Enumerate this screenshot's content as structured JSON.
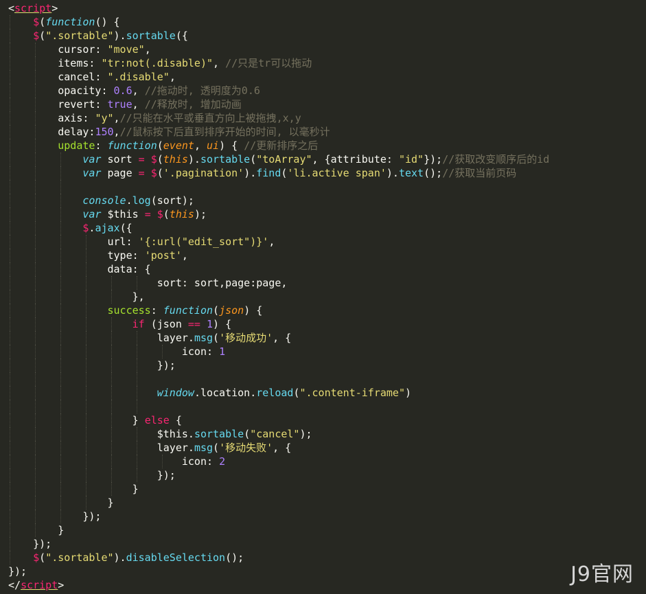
{
  "colors": {
    "background": "#272822",
    "plain": "#f8f8f2",
    "tag": "#f92672",
    "string": "#e6db74",
    "number": "#ae81ff",
    "comment": "#75715e",
    "keyword": "#f92672",
    "function": "#66d9ef",
    "param": "#fd971f",
    "property": "#a6e22e"
  },
  "code": {
    "lines": [
      {
        "indent": 0,
        "tokens": [
          [
            "plain",
            "<"
          ],
          [
            "tag-u",
            "script"
          ],
          [
            "plain",
            ">"
          ]
        ]
      },
      {
        "indent": 1,
        "tokens": [
          [
            "kw",
            "$"
          ],
          [
            "plain",
            "("
          ],
          [
            "fn-i",
            "function"
          ],
          [
            "plain",
            "() {"
          ]
        ]
      },
      {
        "indent": 1,
        "tokens": [
          [
            "kw",
            "$"
          ],
          [
            "plain",
            "("
          ],
          [
            "str",
            "\".sortable\""
          ],
          [
            "plain",
            ")."
          ],
          [
            "fn",
            "sortable"
          ],
          [
            "plain",
            "({"
          ]
        ]
      },
      {
        "indent": 2,
        "tokens": [
          [
            "plain",
            "cursor: "
          ],
          [
            "str",
            "\"move\""
          ],
          [
            "plain",
            ","
          ]
        ]
      },
      {
        "indent": 2,
        "tokens": [
          [
            "plain",
            "items: "
          ],
          [
            "str",
            "\"tr:not(.disable)\""
          ],
          [
            "plain",
            ", "
          ],
          [
            "comment",
            "//只是tr可以拖动"
          ]
        ]
      },
      {
        "indent": 2,
        "tokens": [
          [
            "plain",
            "cancel: "
          ],
          [
            "str",
            "\".disable\""
          ],
          [
            "plain",
            ","
          ]
        ]
      },
      {
        "indent": 2,
        "tokens": [
          [
            "plain",
            "opacity: "
          ],
          [
            "num",
            "0.6"
          ],
          [
            "plain",
            ", "
          ],
          [
            "comment",
            "//拖动时, 透明度为0.6"
          ]
        ]
      },
      {
        "indent": 2,
        "tokens": [
          [
            "plain",
            "revert: "
          ],
          [
            "num",
            "true"
          ],
          [
            "plain",
            ", "
          ],
          [
            "comment",
            "//释放时, 增加动画"
          ]
        ]
      },
      {
        "indent": 2,
        "tokens": [
          [
            "plain",
            "axis: "
          ],
          [
            "str",
            "\"y\""
          ],
          [
            "plain",
            ","
          ],
          [
            "comment",
            "//只能在水平或垂直方向上被拖拽,x,y"
          ]
        ]
      },
      {
        "indent": 2,
        "tokens": [
          [
            "plain",
            "delay:"
          ],
          [
            "num",
            "150"
          ],
          [
            "plain",
            ","
          ],
          [
            "comment",
            "//鼠标按下后直到排序开始的时间, 以毫秒计"
          ]
        ]
      },
      {
        "indent": 2,
        "tokens": [
          [
            "prop",
            "update"
          ],
          [
            "plain",
            ": "
          ],
          [
            "fn-i",
            "function"
          ],
          [
            "plain",
            "("
          ],
          [
            "param",
            "event"
          ],
          [
            "plain",
            ", "
          ],
          [
            "param",
            "ui"
          ],
          [
            "plain",
            ") { "
          ],
          [
            "comment",
            "//更新排序之后"
          ]
        ]
      },
      {
        "indent": 3,
        "tokens": [
          [
            "fn-i",
            "var"
          ],
          [
            "plain",
            " sort "
          ],
          [
            "kw",
            "="
          ],
          [
            "plain",
            " "
          ],
          [
            "kw",
            "$"
          ],
          [
            "plain",
            "("
          ],
          [
            "this",
            "this"
          ],
          [
            "plain",
            ")."
          ],
          [
            "fn",
            "sortable"
          ],
          [
            "plain",
            "("
          ],
          [
            "str",
            "\"toArray\""
          ],
          [
            "plain",
            ", {attribute: "
          ],
          [
            "str",
            "\"id\""
          ],
          [
            "plain",
            "});"
          ],
          [
            "comment",
            "//获取改变顺序后的id"
          ]
        ]
      },
      {
        "indent": 3,
        "tokens": [
          [
            "fn-i",
            "var"
          ],
          [
            "plain",
            " page "
          ],
          [
            "kw",
            "="
          ],
          [
            "plain",
            " "
          ],
          [
            "kw",
            "$"
          ],
          [
            "plain",
            "("
          ],
          [
            "str",
            "'.pagination'"
          ],
          [
            "plain",
            ")."
          ],
          [
            "fn",
            "find"
          ],
          [
            "plain",
            "("
          ],
          [
            "str",
            "'li.active span'"
          ],
          [
            "plain",
            ")."
          ],
          [
            "fn",
            "text"
          ],
          [
            "plain",
            "();"
          ],
          [
            "comment",
            "//获取当前页码"
          ]
        ]
      },
      {
        "indent": 3,
        "tokens": []
      },
      {
        "indent": 3,
        "tokens": [
          [
            "fn-i",
            "console"
          ],
          [
            "plain",
            "."
          ],
          [
            "fn",
            "log"
          ],
          [
            "plain",
            "(sort);"
          ]
        ]
      },
      {
        "indent": 3,
        "tokens": [
          [
            "fn-i",
            "var"
          ],
          [
            "plain",
            " $this "
          ],
          [
            "kw",
            "="
          ],
          [
            "plain",
            " "
          ],
          [
            "kw",
            "$"
          ],
          [
            "plain",
            "("
          ],
          [
            "this",
            "this"
          ],
          [
            "plain",
            ");"
          ]
        ]
      },
      {
        "indent": 3,
        "tokens": [
          [
            "kw",
            "$"
          ],
          [
            "plain",
            "."
          ],
          [
            "fn",
            "ajax"
          ],
          [
            "plain",
            "({"
          ]
        ]
      },
      {
        "indent": 4,
        "tokens": [
          [
            "plain",
            "url: "
          ],
          [
            "str",
            "'{:url(\"edit_sort\")}'"
          ],
          [
            "plain",
            ","
          ]
        ]
      },
      {
        "indent": 4,
        "tokens": [
          [
            "plain",
            "type: "
          ],
          [
            "str",
            "'post'"
          ],
          [
            "plain",
            ","
          ]
        ]
      },
      {
        "indent": 4,
        "tokens": [
          [
            "plain",
            "data: {"
          ]
        ]
      },
      {
        "indent": 6,
        "pad": "    ",
        "tokens": [
          [
            "plain",
            "sort: sort,page:page,"
          ]
        ]
      },
      {
        "indent": 5,
        "tokens": [
          [
            "plain",
            "},"
          ]
        ]
      },
      {
        "indent": 4,
        "tokens": [
          [
            "prop",
            "success"
          ],
          [
            "plain",
            ": "
          ],
          [
            "fn-i",
            "function"
          ],
          [
            "plain",
            "("
          ],
          [
            "param",
            "json"
          ],
          [
            "plain",
            ") {"
          ]
        ]
      },
      {
        "indent": 5,
        "tokens": [
          [
            "kw",
            "if"
          ],
          [
            "plain",
            " (json "
          ],
          [
            "kw",
            "=="
          ],
          [
            "plain",
            " "
          ],
          [
            "num",
            "1"
          ],
          [
            "plain",
            ") {"
          ]
        ]
      },
      {
        "indent": 6,
        "tokens": [
          [
            "plain",
            "layer."
          ],
          [
            "fn",
            "msg"
          ],
          [
            "plain",
            "("
          ],
          [
            "str",
            "'移动成功'"
          ],
          [
            "plain",
            ", {"
          ]
        ]
      },
      {
        "indent": 7,
        "tokens": [
          [
            "plain",
            "icon: "
          ],
          [
            "num",
            "1"
          ]
        ]
      },
      {
        "indent": 6,
        "tokens": [
          [
            "plain",
            "});"
          ]
        ]
      },
      {
        "indent": 6,
        "tokens": []
      },
      {
        "indent": 6,
        "tokens": [
          [
            "fn-i",
            "window"
          ],
          [
            "plain",
            ".location."
          ],
          [
            "fn",
            "reload"
          ],
          [
            "plain",
            "("
          ],
          [
            "str",
            "\".content-iframe\""
          ],
          [
            "plain",
            ")"
          ]
        ]
      },
      {
        "indent": 6,
        "tokens": []
      },
      {
        "indent": 5,
        "tokens": [
          [
            "plain",
            "} "
          ],
          [
            "kw",
            "else"
          ],
          [
            "plain",
            " {"
          ]
        ]
      },
      {
        "indent": 6,
        "tokens": [
          [
            "plain",
            "$this."
          ],
          [
            "fn",
            "sortable"
          ],
          [
            "plain",
            "("
          ],
          [
            "str",
            "\"cancel\""
          ],
          [
            "plain",
            ");"
          ]
        ]
      },
      {
        "indent": 6,
        "tokens": [
          [
            "plain",
            "layer."
          ],
          [
            "fn",
            "msg"
          ],
          [
            "plain",
            "("
          ],
          [
            "str",
            "'移动失败'"
          ],
          [
            "plain",
            ", {"
          ]
        ]
      },
      {
        "indent": 7,
        "tokens": [
          [
            "plain",
            "icon: "
          ],
          [
            "num",
            "2"
          ]
        ]
      },
      {
        "indent": 6,
        "tokens": [
          [
            "plain",
            "});"
          ]
        ]
      },
      {
        "indent": 5,
        "tokens": [
          [
            "plain",
            "}"
          ]
        ]
      },
      {
        "indent": 4,
        "tokens": [
          [
            "plain",
            "}"
          ]
        ]
      },
      {
        "indent": 3,
        "tokens": [
          [
            "plain",
            "});"
          ]
        ]
      },
      {
        "indent": 2,
        "tokens": [
          [
            "plain",
            "}"
          ]
        ]
      },
      {
        "indent": 1,
        "tokens": [
          [
            "plain",
            "});"
          ]
        ]
      },
      {
        "indent": 1,
        "tokens": [
          [
            "kw",
            "$"
          ],
          [
            "plain",
            "("
          ],
          [
            "str",
            "\".sortable\""
          ],
          [
            "plain",
            ")."
          ],
          [
            "fn",
            "disableSelection"
          ],
          [
            "plain",
            "();"
          ]
        ]
      },
      {
        "indent": 0,
        "tokens": [
          [
            "plain",
            "});"
          ]
        ]
      },
      {
        "indent": 0,
        "tokens": [
          [
            "plain",
            "</"
          ],
          [
            "tag-u",
            "script"
          ],
          [
            "plain",
            ">"
          ]
        ]
      }
    ]
  },
  "watermark": {
    "text": "J9官网"
  }
}
